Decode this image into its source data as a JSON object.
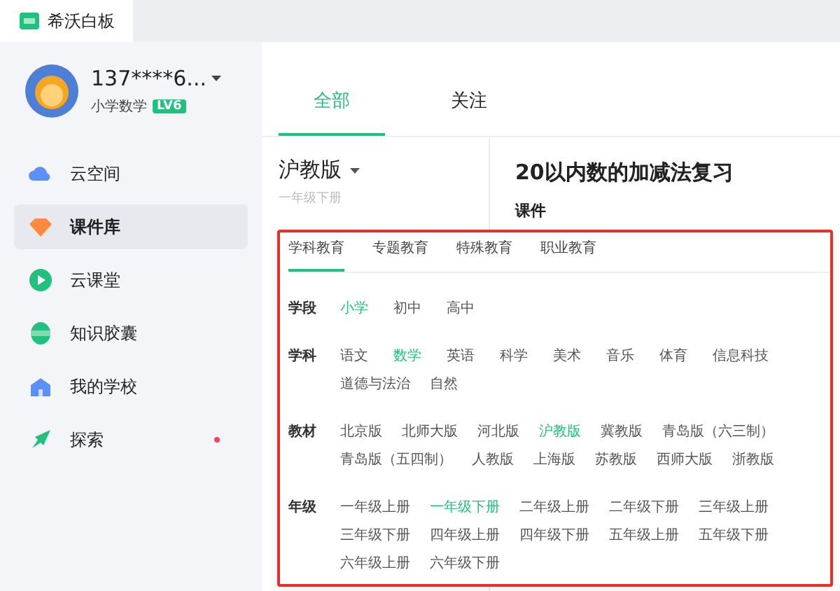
{
  "app": {
    "title": "希沃白板"
  },
  "user": {
    "name": "137****6...",
    "subject": "小学数学",
    "level": "LV6"
  },
  "sidebar": {
    "items": [
      {
        "label": "云空间",
        "selected": false,
        "dot": false
      },
      {
        "label": "课件库",
        "selected": true,
        "dot": false
      },
      {
        "label": "云课堂",
        "selected": false,
        "dot": false
      },
      {
        "label": "知识胶囊",
        "selected": false,
        "dot": false
      },
      {
        "label": "我的学校",
        "selected": false,
        "dot": false
      },
      {
        "label": "探索",
        "selected": false,
        "dot": true
      }
    ]
  },
  "tabs": [
    {
      "label": "全部",
      "selected": true
    },
    {
      "label": "关注",
      "selected": false
    }
  ],
  "edition": {
    "label": "沪教版",
    "grade": "一年级下册"
  },
  "lesson": {
    "title": "20以内数的加减法复习",
    "section": "课件"
  },
  "filter": {
    "tabs": [
      {
        "label": "学科教育",
        "selected": true
      },
      {
        "label": "专题教育",
        "selected": false
      },
      {
        "label": "特殊教育",
        "selected": false
      },
      {
        "label": "职业教育",
        "selected": false
      }
    ],
    "groups": [
      {
        "label": "学段",
        "options": [
          {
            "label": "小学",
            "selected": true
          },
          {
            "label": "初中",
            "selected": false
          },
          {
            "label": "高中",
            "selected": false
          }
        ]
      },
      {
        "label": "学科",
        "options": [
          {
            "label": "语文",
            "selected": false
          },
          {
            "label": "数学",
            "selected": true
          },
          {
            "label": "英语",
            "selected": false
          },
          {
            "label": "科学",
            "selected": false
          },
          {
            "label": "美术",
            "selected": false
          },
          {
            "label": "音乐",
            "selected": false
          },
          {
            "label": "体育",
            "selected": false
          },
          {
            "label": "信息科技",
            "selected": false
          },
          {
            "label": "道德与法治",
            "selected": false
          },
          {
            "label": "自然",
            "selected": false
          }
        ]
      },
      {
        "label": "教材",
        "options": [
          {
            "label": "北京版",
            "selected": false
          },
          {
            "label": "北师大版",
            "selected": false
          },
          {
            "label": "河北版",
            "selected": false
          },
          {
            "label": "沪教版",
            "selected": true
          },
          {
            "label": "冀教版",
            "selected": false
          },
          {
            "label": "青岛版（六三制）",
            "selected": false
          },
          {
            "label": "青岛版（五四制）",
            "selected": false
          },
          {
            "label": "人教版",
            "selected": false
          },
          {
            "label": "上海版",
            "selected": false
          },
          {
            "label": "苏教版",
            "selected": false
          },
          {
            "label": "西师大版",
            "selected": false
          },
          {
            "label": "浙教版",
            "selected": false
          }
        ]
      },
      {
        "label": "年级",
        "options": [
          {
            "label": "一年级上册",
            "selected": false
          },
          {
            "label": "一年级下册",
            "selected": true
          },
          {
            "label": "二年级上册",
            "selected": false
          },
          {
            "label": "二年级下册",
            "selected": false
          },
          {
            "label": "三年级上册",
            "selected": false
          },
          {
            "label": "三年级下册",
            "selected": false
          },
          {
            "label": "四年级上册",
            "selected": false
          },
          {
            "label": "四年级下册",
            "selected": false
          },
          {
            "label": "五年级上册",
            "selected": false
          },
          {
            "label": "五年级下册",
            "selected": false
          },
          {
            "label": "六年级上册",
            "selected": false
          },
          {
            "label": "六年级下册",
            "selected": false
          }
        ]
      }
    ]
  }
}
